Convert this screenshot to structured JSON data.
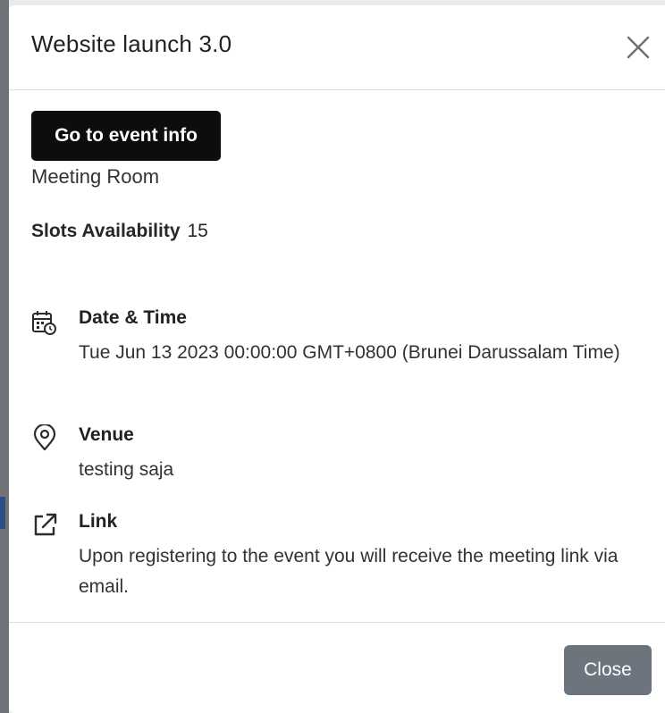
{
  "modal": {
    "title": "Website launch 3.0",
    "event_button_label": "Go to event info",
    "room_type": "Meeting Room",
    "slots_label": "Slots Availability",
    "slots_value": "15",
    "date_time": {
      "icon": "calendar-clock-icon",
      "title": "Date & Time",
      "value": "Tue Jun 13 2023 00:00:00 GMT+0800 (Brunei Darussalam Time)"
    },
    "venue": {
      "icon": "location-pin-icon",
      "title": "Venue",
      "value": "testing saja"
    },
    "link": {
      "icon": "external-link-icon",
      "title": "Link",
      "value": "Upon registering to the event you will receive the meeting link via email."
    },
    "close_button_label": "Close"
  },
  "colors": {
    "primary_button": "#0c0d0f",
    "secondary_button": "#6d747d",
    "divider": "#dcdde0"
  }
}
